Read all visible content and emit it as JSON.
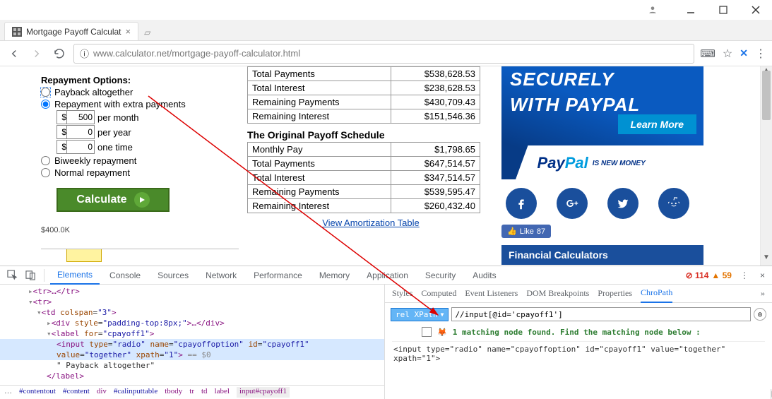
{
  "window": {
    "tab_title": "Mortgage Payoff Calculat",
    "url_display": "www.calculator.net/mortgage-payoff-calculator.html"
  },
  "repayment": {
    "section_label": "Repayment Options:",
    "opt_payback": "Payback altogether",
    "opt_extra": "Repayment with extra payments",
    "per_month_val": "500",
    "per_month_lbl": "per month",
    "per_year_val": "0",
    "per_year_lbl": "per year",
    "one_time_val": "0",
    "one_time_lbl": "one time",
    "opt_biweekly": "Biweekly repayment",
    "opt_normal": "Normal repayment",
    "calc_btn": "Calculate",
    "y_label": "$400.0K"
  },
  "table1": {
    "r1k": "Total Payments",
    "r1v": "$538,628.53",
    "r2k": "Total Interest",
    "r2v": "$238,628.53",
    "r3k": "Remaining Payments",
    "r3v": "$430,709.43",
    "r4k": "Remaining Interest",
    "r4v": "$151,546.36"
  },
  "table2": {
    "title": "The Original Payoff Schedule",
    "r1k": "Monthly Pay",
    "r1v": "$1,798.65",
    "r2k": "Total Payments",
    "r2v": "$647,514.57",
    "r3k": "Total Interest",
    "r3v": "$347,514.57",
    "r4k": "Remaining Payments",
    "r4v": "$539,595.47",
    "r5k": "Remaining Interest",
    "r5v": "$260,432.40"
  },
  "amort_link": "View Amortization Table",
  "paypal": {
    "line1": "SECURELY",
    "line2": "WITH PAYPAL",
    "learn": "Learn More",
    "tagline": "IS NEW MONEY"
  },
  "like": {
    "label": "Like",
    "count": "87"
  },
  "fc_header": "Financial Calculators",
  "devtools": {
    "tabs": [
      "Elements",
      "Console",
      "Sources",
      "Network",
      "Performance",
      "Memory",
      "Application",
      "Security",
      "Audits"
    ],
    "err_count": "114",
    "warn_count": "59",
    "right_tabs": [
      "Styles",
      "Computed",
      "Event Listeners",
      "DOM Breakpoints",
      "Properties",
      "ChroPath"
    ],
    "dom_lines": {
      "l1": "<tr>…</tr>",
      "l2": "<tr>",
      "l3a": "<td ",
      "l3b": "colspan",
      "l3c": "\"3\"",
      "l3d": ">",
      "l4a": "<div ",
      "l4b": "style",
      "l4c": "\"padding-top:8px;\"",
      "l4d": ">…</div>",
      "l5a": "<label ",
      "l5b": "for",
      "l5c": "\"cpayoff1\"",
      "l5d": ">",
      "l6": "<input type=\"radio\" name=\"cpayoffoption\" id=\"cpayoff1\" value=\"together\" xpath=\"1\">",
      "l6b": " == $0",
      "l7": "\" Payback altogether\"",
      "l8": "</label>"
    },
    "crumbs": [
      "…",
      "#contentout",
      "#content",
      "div",
      "#calinputtable",
      "tbody",
      "tr",
      "td",
      "label",
      "input#cpayoff1"
    ],
    "chropath": {
      "selector_label": "rel XPath",
      "query": "//input[@id='cpayoff1']",
      "found_msg": "1 matching node found. Find the matching node below :",
      "node": "<input type=\"radio\" name=\"cpayoffoption\" id=\"cpayoff1\" value=\"together\" xpath=\"1\">"
    }
  }
}
